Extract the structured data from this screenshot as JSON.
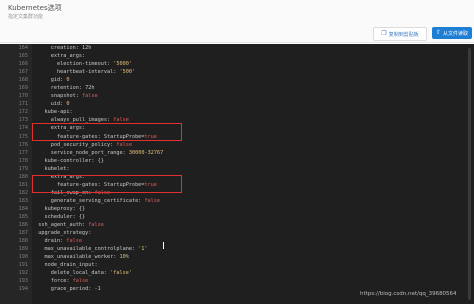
{
  "header": {
    "title": "Kubernetes选项",
    "subtitle": "指定文集群功能"
  },
  "toolbar": {
    "copy_label": "复制到剪贴板",
    "read_label": "从文件读取"
  },
  "editor": {
    "lines": [
      {
        "n": "164",
        "text": "      creation: 12h"
      },
      {
        "n": "165",
        "text": "      extra_args:"
      },
      {
        "n": "166",
        "text": "        election-timeout: '5000'"
      },
      {
        "n": "167",
        "text": "        heartbeat-interval: '500'"
      },
      {
        "n": "168",
        "text": "      gid: 0"
      },
      {
        "n": "169",
        "text": "      retention: 72h"
      },
      {
        "n": "170",
        "text": "      snapshot: false"
      },
      {
        "n": "171",
        "text": "      uid: 0"
      },
      {
        "n": "172",
        "text": "    kube-api:"
      },
      {
        "n": "173",
        "text": "      always_pull_images: false"
      },
      {
        "n": "174",
        "text": "      extra_args:"
      },
      {
        "n": "175",
        "text": "        feature-gates: StartupProbe=true"
      },
      {
        "n": "176",
        "text": "      pod_security_policy: false"
      },
      {
        "n": "177",
        "text": "      service_node_port_range: 30000-32767"
      },
      {
        "n": "178",
        "text": "    kube-controller: {}"
      },
      {
        "n": "179",
        "text": "    kubelet:"
      },
      {
        "n": "180",
        "text": "      extra_args:"
      },
      {
        "n": "181",
        "text": "        feature-gates: StartupProbe=true"
      },
      {
        "n": "182",
        "text": "      fail_swap_on: false"
      },
      {
        "n": "183",
        "text": "      generate_serving_certificate: false"
      },
      {
        "n": "184",
        "text": "    kubeproxy: {}"
      },
      {
        "n": "185",
        "text": "    scheduler: {}"
      },
      {
        "n": "186",
        "text": "  ssh_agent_auth: false"
      },
      {
        "n": "187",
        "text": "  upgrade_strategy:"
      },
      {
        "n": "188",
        "text": "    drain: false"
      },
      {
        "n": "189",
        "text": "    max_unavailable_controlplane: '1'"
      },
      {
        "n": "190",
        "text": "    max_unavailable_worker: 10%"
      },
      {
        "n": "191",
        "text": "    node_drain_input:"
      },
      {
        "n": "192",
        "text": "      delete_local_data: 'false'"
      },
      {
        "n": "193",
        "text": "      force: false"
      },
      {
        "n": "194",
        "text": "      grace_period: -1"
      }
    ]
  },
  "watermark": "https://blog.csdn.net/qq_39680564"
}
